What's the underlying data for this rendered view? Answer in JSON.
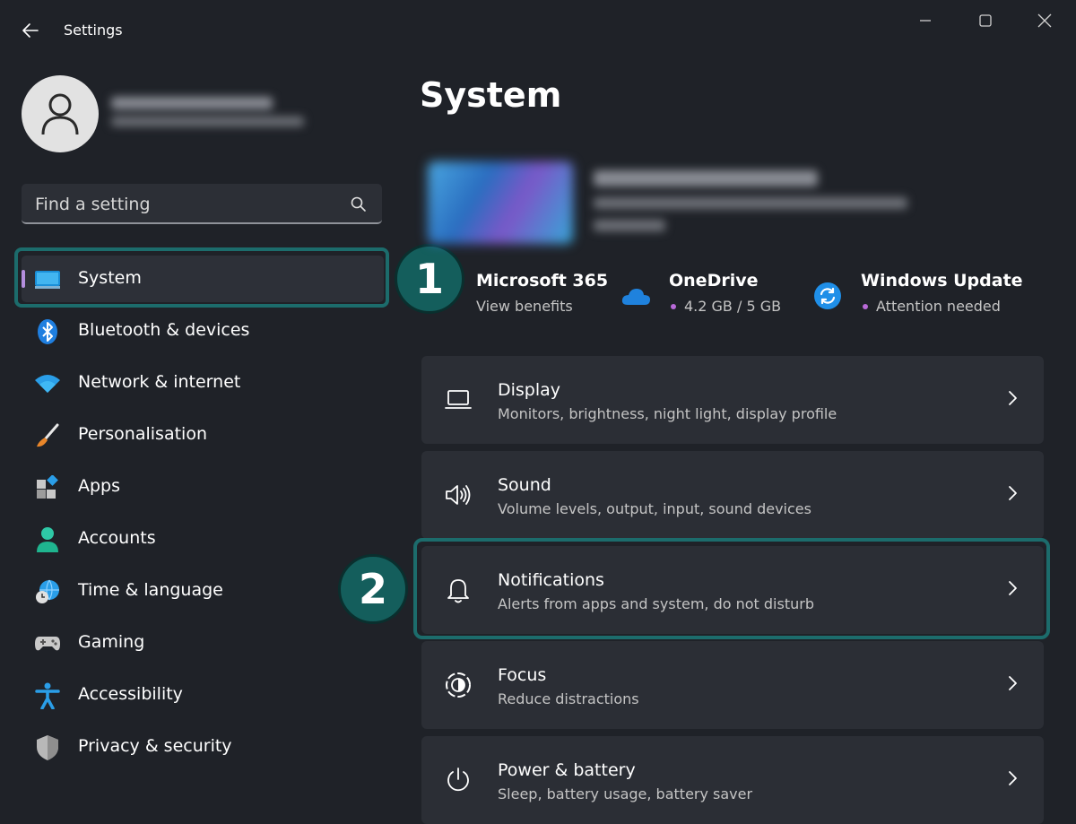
{
  "window": {
    "title": "Settings"
  },
  "search": {
    "placeholder": "Find a setting"
  },
  "sidebar": {
    "items": [
      {
        "label": "System",
        "icon": "monitor-icon",
        "active": true
      },
      {
        "label": "Bluetooth & devices",
        "icon": "bluetooth-icon"
      },
      {
        "label": "Network & internet",
        "icon": "wifi-icon"
      },
      {
        "label": "Personalisation",
        "icon": "brush-icon"
      },
      {
        "label": "Apps",
        "icon": "apps-icon"
      },
      {
        "label": "Accounts",
        "icon": "accounts-icon"
      },
      {
        "label": "Time & language",
        "icon": "globe-clock-icon"
      },
      {
        "label": "Gaming",
        "icon": "gamepad-icon"
      },
      {
        "label": "Accessibility",
        "icon": "accessibility-icon"
      },
      {
        "label": "Privacy & security",
        "icon": "shield-icon"
      }
    ]
  },
  "main": {
    "title": "System",
    "quick_links": [
      {
        "title": "Microsoft 365",
        "subtitle": "View benefits",
        "icon": "microsoft-365-icon"
      },
      {
        "title": "OneDrive",
        "subtitle": "4.2 GB / 5 GB",
        "icon": "cloud-icon"
      },
      {
        "title": "Windows Update",
        "subtitle": "Attention needed",
        "icon": "update-icon"
      }
    ],
    "cards": [
      {
        "title": "Display",
        "subtitle": "Monitors, brightness, night light, display profile",
        "icon": "laptop-icon"
      },
      {
        "title": "Sound",
        "subtitle": "Volume levels, output, input, sound devices",
        "icon": "speaker-icon"
      },
      {
        "title": "Notifications",
        "subtitle": "Alerts from apps and system, do not disturb",
        "icon": "bell-icon"
      },
      {
        "title": "Focus",
        "subtitle": "Reduce distractions",
        "icon": "focus-icon"
      },
      {
        "title": "Power & battery",
        "subtitle": "Sleep, battery usage, battery saver",
        "icon": "power-icon"
      }
    ]
  },
  "annotations": {
    "badge1": "1",
    "badge2": "2"
  },
  "colors": {
    "background": "#1f2228",
    "card": "#2b2e35",
    "accent_pill": "#b48ede",
    "highlight": "#1c6c6c",
    "badge": "#145e5c"
  }
}
